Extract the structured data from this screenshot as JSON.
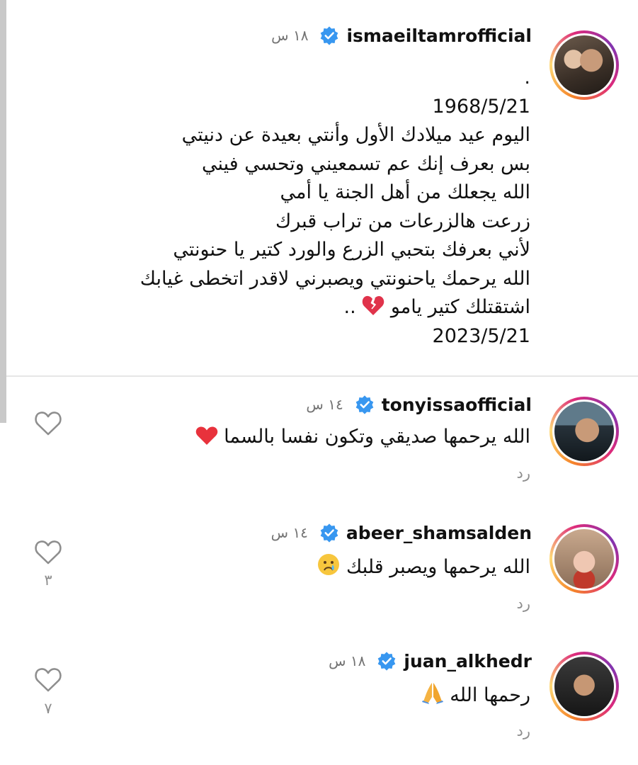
{
  "post": {
    "username": "ismaeiltamrofficial",
    "time": "١٨ س",
    "caption_lines": [
      ".",
      "1968/5/21",
      "اليوم عيد ميلادك الأول وأنتي بعيدة عن دنيتي",
      "بس بعرف إنك عم تسمعيني وتحسي فيني",
      "الله يجعلك من أهل الجنة يا أمي",
      "زرعت هالزرعات من تراب قبرك",
      "لأني بعرفك بتحبي الزرع والورد كتير يا حنونتي",
      "الله يرحمك ياحنونتي ويصبرني لاقدر اتخطى غيابك",
      "اشتقتلك كتير يامو",
      "..",
      "2023/5/21"
    ]
  },
  "comments": [
    {
      "username": "tonyissaofficial",
      "time": "١٤ س",
      "text": "الله يرحمها صديقي وتكون نفسا بالسما",
      "reply": "رد",
      "likes": ""
    },
    {
      "username": "abeer_shamsalden",
      "time": "١٤ س",
      "text": "الله يرحمها ويصبر قلبك",
      "reply": "رد",
      "likes": "٣"
    },
    {
      "username": "juan_alkhedr",
      "time": "١٨ س",
      "text": "رحمها الله",
      "reply": "رد",
      "likes": "٧"
    }
  ],
  "icons": {
    "verified": "verified-badge-icon",
    "heart": "heart-outline-icon",
    "broken_heart": "broken-heart-emoji",
    "red_heart": "red-heart-emoji",
    "crying": "crying-face-emoji",
    "pray": "folded-hands-emoji"
  },
  "colors": {
    "verified": "#3897f0",
    "muted": "#8e8e8e",
    "ring_start": "#f58529",
    "ring_end": "#dd2a7b"
  }
}
